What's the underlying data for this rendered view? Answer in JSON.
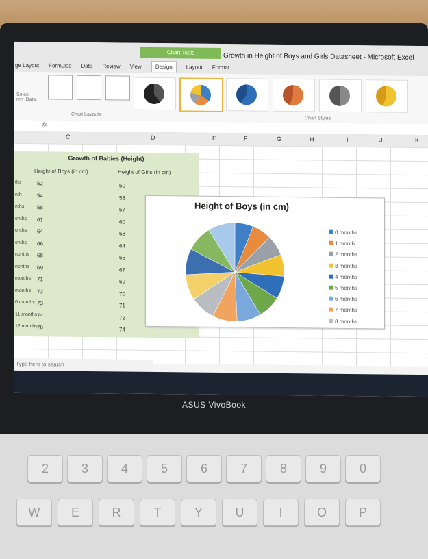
{
  "window": {
    "title": "Growth in Height of Boys and Girls Datasheet - Microsoft Excel"
  },
  "ribbon": {
    "context_tab": "Chart Tools",
    "tabs": [
      "ge Layout",
      "Formulas",
      "Data",
      "Review",
      "View",
      "Design",
      "Layout",
      "Format"
    ],
    "active_tab": "Design",
    "select_data": "Select\nmn  Data",
    "group_chart_layouts": "Chart Layouts",
    "group_chart_styles": "Chart Styles"
  },
  "formula_bar": {
    "fx": "fx"
  },
  "columns": [
    "C",
    "D",
    "E",
    "F",
    "G",
    "H",
    "I",
    "J",
    "K"
  ],
  "table": {
    "title": "Growth of Babies (Height)",
    "headers": [
      "Height of Boys (in cm)",
      "Height of Girls (in cm)"
    ],
    "row_labels": [
      "ths",
      "nth",
      "nths",
      "onths",
      "onths",
      "onths",
      "nonths",
      "nonths",
      "months",
      "months",
      "0 months",
      "11 months",
      "12 months"
    ],
    "boys": [
      52,
      54,
      58,
      61,
      64,
      66,
      68,
      69,
      71,
      72,
      73,
      74,
      76
    ],
    "girls": [
      50,
      53,
      57,
      60,
      63,
      64,
      66,
      67,
      69,
      70,
      71,
      72,
      74
    ]
  },
  "chart_data": {
    "type": "pie",
    "title": "Height of Boys (in cm)",
    "categories": [
      "0 months",
      "1 month",
      "2 months",
      "3 months",
      "4 months",
      "5 months",
      "6 months",
      "7 months",
      "8 months"
    ],
    "values": [
      52,
      54,
      58,
      61,
      64,
      66,
      68,
      69,
      71,
      72,
      73,
      74,
      76
    ],
    "colors": [
      "#3e7fc6",
      "#e88b3c",
      "#9aa0a8",
      "#f2c331",
      "#2f6fb9",
      "#6fa84a",
      "#7aa8dd",
      "#f0a460",
      "#b9bcc0",
      "#f4d06a",
      "#3b6fb0",
      "#86b95f",
      "#a9c9ea"
    ],
    "legend_position": "right"
  },
  "status": {
    "search_placeholder": "Type here to search"
  },
  "laptop": {
    "brand": "ASUS VivoBook"
  },
  "keys": [
    "2",
    "3",
    "4",
    "5",
    "6",
    "7",
    "8",
    "9",
    "0",
    "W",
    "E",
    "R",
    "T",
    "Y",
    "U",
    "I",
    "O",
    "P"
  ]
}
